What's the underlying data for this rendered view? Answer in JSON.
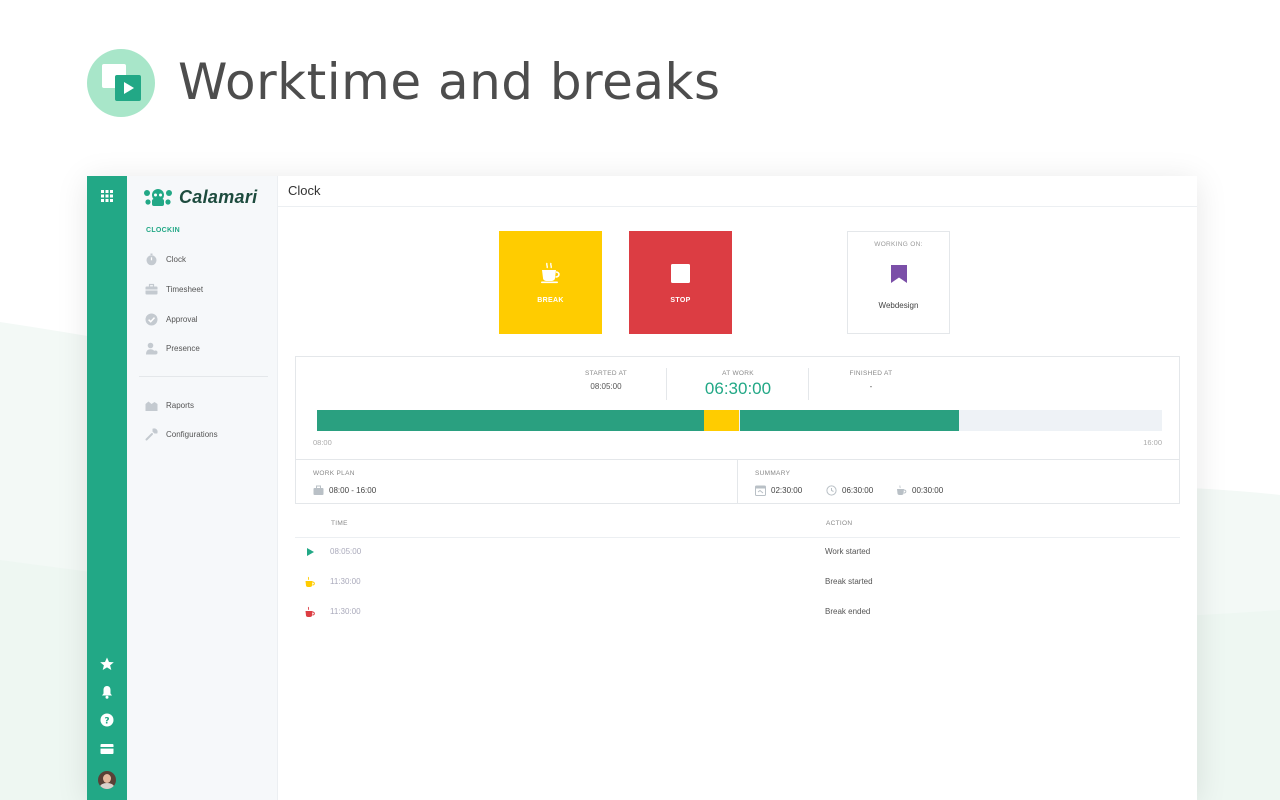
{
  "promo": {
    "title": "Worktime and breaks"
  },
  "sidebar": {
    "logo": "Calamari",
    "section": "CLOCKIN",
    "items": [
      {
        "label": "Clock",
        "icon": "stopwatch-icon"
      },
      {
        "label": "Timesheet",
        "icon": "briefcase-icon"
      },
      {
        "label": "Approval",
        "icon": "check-circle-icon"
      },
      {
        "label": "Presence",
        "icon": "person-icon"
      },
      {
        "label": "Raports",
        "icon": "chart-icon"
      },
      {
        "label": "Configurations",
        "icon": "wrench-icon"
      }
    ]
  },
  "rail": {
    "icons": [
      "apps-grid-icon",
      "star-icon",
      "bell-icon",
      "help-icon",
      "card-icon",
      "avatar"
    ]
  },
  "main": {
    "title": "Clock",
    "break_label": "BREAK",
    "stop_label": "STOP",
    "working_on_label": "WORKING ON:",
    "working_on_value": "Webdesign"
  },
  "stats": {
    "started_label": "STARTED AT",
    "started_value": "08:05:00",
    "atwork_label": "AT WORK",
    "atwork_value": "06:30:00",
    "finished_label": "FINISHED AT",
    "finished_value": "-"
  },
  "timeline": {
    "start": "08:00",
    "end": "16:00",
    "segments": [
      {
        "type": "work",
        "from": 0.0,
        "to": 0.458,
        "color": "#2aa080"
      },
      {
        "type": "break",
        "from": 0.458,
        "to": 0.5,
        "color": "#ffcc00"
      },
      {
        "type": "work",
        "from": 0.5,
        "to": 0.759,
        "color": "#2aa080"
      }
    ]
  },
  "workplan": {
    "label": "WORK PLAN",
    "value": "08:00 - 16:00"
  },
  "summary": {
    "label": "SUMMARY",
    "values": [
      "02:30:00",
      "06:30:00",
      "00:30:00"
    ]
  },
  "table": {
    "col_time": "TIME",
    "col_action": "ACTION",
    "rows": [
      {
        "time": "08:05:00",
        "action": "Work started",
        "icon": "play-icon",
        "color": "#22a886"
      },
      {
        "time": "11:30:00",
        "action": "Break started",
        "icon": "coffee-icon",
        "color": "#ffcc00"
      },
      {
        "time": "11:30:00",
        "action": "Break ended",
        "icon": "coffee-icon",
        "color": "#dc3d43"
      }
    ]
  },
  "colors": {
    "brand": "#22a886",
    "break": "#ffcc00",
    "stop": "#dc3d43",
    "working": "#7b4fa8"
  }
}
